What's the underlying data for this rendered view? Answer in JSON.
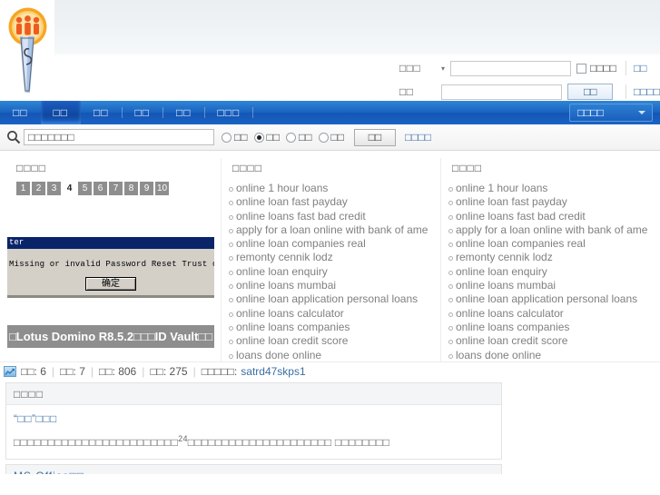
{
  "header": {
    "logo_name": "site-logo",
    "form": {
      "row1": {
        "label": "□□□",
        "dropdown_caret": "▾",
        "input_value": "",
        "checkbox_label": "□□□□",
        "link": "□□"
      },
      "row2": {
        "label": "□□",
        "input_value": "",
        "button": "□□",
        "link": "□□□□"
      }
    }
  },
  "nav": {
    "items": [
      {
        "label": "□□",
        "active": false
      },
      {
        "label": "□□",
        "active": true
      },
      {
        "label": "□□",
        "active": false
      },
      {
        "label": "□□",
        "active": false
      },
      {
        "label": "□□",
        "active": false
      },
      {
        "label": "□□□",
        "active": false
      }
    ],
    "right_dropdown": "□□□□"
  },
  "search": {
    "placeholder": "□□□□□□□",
    "value": "□□□□□□□",
    "radios": [
      {
        "label": "□□",
        "selected": false
      },
      {
        "label": "□□",
        "selected": true
      },
      {
        "label": "□□",
        "selected": false
      },
      {
        "label": "□□",
        "selected": false
      }
    ],
    "button": "□□",
    "advanced_link": "□□□□"
  },
  "columns": {
    "left": {
      "title": "□□□□",
      "pages": [
        "1",
        "2",
        "3",
        "4",
        "5",
        "6",
        "7",
        "8",
        "9",
        "10"
      ],
      "current_page": "4",
      "dialog": {
        "titlebar": "ter",
        "message": "Missing or invalid Password Reset Trust certificate. Check t",
        "ok_button": "确定"
      },
      "caption": "□Lotus Domino R8.5.2□□□ID Vault□□"
    },
    "middle": {
      "title": "□□□□",
      "items": [
        "online 1 hour loans",
        "online loan fast payday",
        "online loans fast bad credit",
        "apply for a loan online with bank of ame",
        "online loan companies real",
        "remonty cennik lodz",
        "online loan enquiry",
        "online loans mumbai",
        "online loan application personal loans",
        "online loans calculator",
        "online loans companies",
        "online loan credit score",
        "loans done online"
      ]
    },
    "right": {
      "title": "□□□□",
      "items": [
        "online 1 hour loans",
        "online loan fast payday",
        "online loans fast bad credit",
        "apply for a loan online with bank of ame",
        "online loan companies real",
        "remonty cennik lodz",
        "online loan enquiry",
        "online loans mumbai",
        "online loan application personal loans",
        "online loans calculator",
        "online loans companies",
        "online loan credit score",
        "loans done online"
      ]
    }
  },
  "stats": {
    "item1_label": "□□:",
    "item1_value": "6",
    "item2_label": "□□:",
    "item2_value": "7",
    "item3_label": "□□:",
    "item3_value": "806",
    "item4_label": "□□:",
    "item4_value": "275",
    "user_label": "□□□□□:",
    "user_value": "satrd47skps1"
  },
  "panels": [
    {
      "head": "□□□□",
      "item_title": "“□□”□□□",
      "item_desc_a": "□□□□□□□□□□□□□□□□□□□□□□□□",
      "item_desc_sup": "24",
      "item_desc_b": "□□□□□□□□□□□□□□□□□□□□□ □□□□□□□□"
    },
    {
      "head": "MS Office□□"
    }
  ],
  "colors": {
    "nav_blue": "#1456b4",
    "link_blue": "#3a6ea5",
    "pager_gray": "#8e8e8e",
    "dialog_title_blue": "#0a246a",
    "logo_orange": "#f0882a"
  }
}
